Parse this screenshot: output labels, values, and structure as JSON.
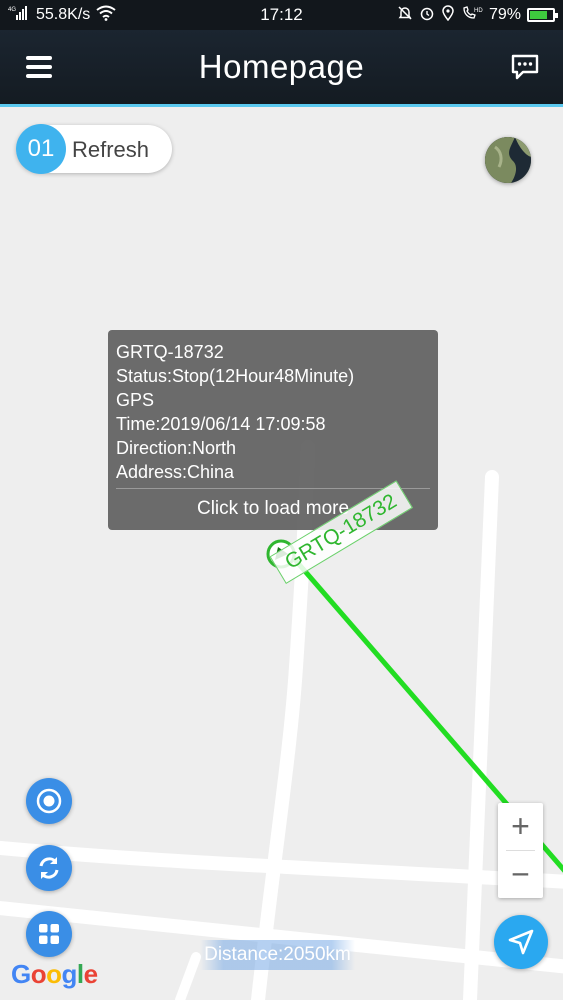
{
  "status_bar": {
    "network": "4G",
    "speed": "55.8K/s",
    "time": "17:12",
    "battery": "79%",
    "battery_level": 0.79
  },
  "header": {
    "title": "Homepage"
  },
  "map": {
    "refresh": {
      "count": "01",
      "label": "Refresh"
    },
    "info_window": {
      "plate": "GRTQ-18732",
      "status": "Status:Stop(12Hour48Minute)",
      "positioning": "GPS",
      "time": "Time:2019/06/14 17:09:58",
      "direction": "Direction:North",
      "address": "Address:China",
      "load_more": "Click to load more"
    },
    "vehicle_label": "GRTQ-18732",
    "distance": "Distance:2050km",
    "zoom_in": "+",
    "zoom_out": "−",
    "google": [
      "G",
      "o",
      "o",
      "g",
      "l",
      "e"
    ]
  },
  "colors": {
    "accent": "#5ac8ee",
    "route": "#22dd22",
    "fab": "#3a8ee6",
    "nav_fab": "#2aa8f0"
  }
}
